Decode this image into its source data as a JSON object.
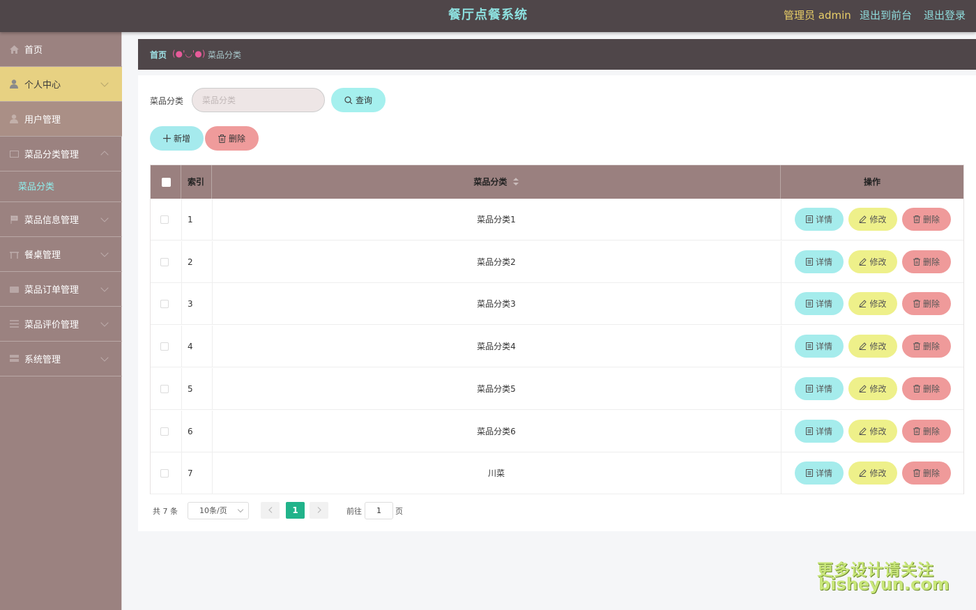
{
  "header": {
    "title": "餐厅点餐系统",
    "user_label": "管理员 admin",
    "front_label": "退出到前台",
    "logout_label": "退出登录"
  },
  "sidebar": {
    "items": [
      {
        "label": "首页",
        "icon": "home-icon"
      },
      {
        "label": "个人中心",
        "icon": "user-icon"
      },
      {
        "label": "用户管理",
        "icon": "user-icon"
      },
      {
        "label": "菜品分类管理",
        "icon": "category-icon"
      },
      {
        "label": "菜品信息管理",
        "icon": "flag-icon"
      },
      {
        "label": "餐桌管理",
        "icon": "table-icon"
      },
      {
        "label": "菜品订单管理",
        "icon": "cart-icon"
      },
      {
        "label": "菜品评价管理",
        "icon": "list-icon"
      },
      {
        "label": "系统管理",
        "icon": "system-icon"
      }
    ],
    "submenu_active": "菜品分类"
  },
  "breadcrumb": {
    "home": "首页",
    "separator": "(●'◡'●)",
    "current": "菜品分类"
  },
  "search": {
    "label": "菜品分类",
    "placeholder": "菜品分类",
    "value": "",
    "query_button": "查询"
  },
  "actions": {
    "add_button": "新增",
    "delete_button": "删除"
  },
  "table": {
    "headers": {
      "index": "索引",
      "category": "菜品分类",
      "operation": "操作"
    },
    "rows": [
      {
        "index": "1",
        "category": "菜品分类1"
      },
      {
        "index": "2",
        "category": "菜品分类2"
      },
      {
        "index": "3",
        "category": "菜品分类3"
      },
      {
        "index": "4",
        "category": "菜品分类4"
      },
      {
        "index": "5",
        "category": "菜品分类5"
      },
      {
        "index": "6",
        "category": "菜品分类6"
      },
      {
        "index": "7",
        "category": "川菜"
      }
    ],
    "row_actions": {
      "detail": "详情",
      "edit": "修改",
      "remove": "删除"
    }
  },
  "pagination": {
    "total": "共 7 条",
    "page_size": "10条/页",
    "current_page": "1",
    "goto_label": "前往",
    "goto_value": "1",
    "goto_suffix": "页"
  },
  "watermark": {
    "line1": "更多设计请关注",
    "line2": "bisheyun.com"
  },
  "colors": {
    "topbar_bg": "#4f4649",
    "sidebar_bg": "#9b8280",
    "active_menu_bg": "#e7d182",
    "table_header_bg": "#9a807f",
    "detail_btn": "#a5ecec",
    "edit_btn": "#eef08a",
    "delete_btn": "#ef9a9a",
    "page_active": "#21b38a"
  }
}
